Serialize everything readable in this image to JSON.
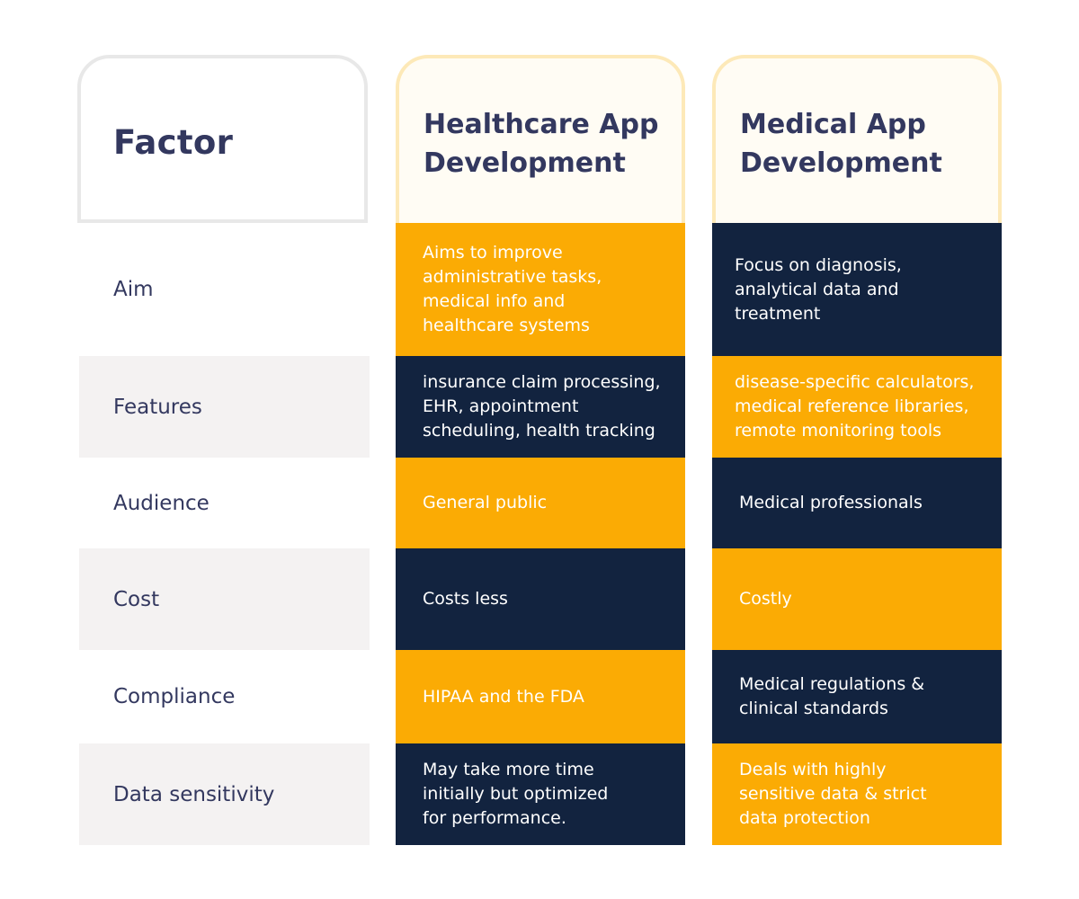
{
  "headers": {
    "factor": "Factor",
    "col1": "Healthcare App Development",
    "col2": "Medical App Development"
  },
  "colors": {
    "navy": "#12233f",
    "amber": "#fbab04",
    "text_dark": "#33385f",
    "row_shade": "#f4f2f2",
    "header_border": "#fde9b8"
  },
  "rows": [
    {
      "factor": "Aim",
      "healthcare": "Aims to improve administrative tasks, medical info and healthcare systems",
      "medical": "Focus on diagnosis, analytical data and treatment"
    },
    {
      "factor": "Features",
      "healthcare": "insurance claim processing, EHR, appointment scheduling, health tracking",
      "medical": "disease-specific calculators, medical reference libraries, remote monitoring tools"
    },
    {
      "factor": "Audience",
      "healthcare": "General public",
      "medical": "Medical professionals"
    },
    {
      "factor": "Cost",
      "healthcare": "Costs less",
      "medical": "Costly"
    },
    {
      "factor": "Compliance",
      "healthcare": "HIPAA and the FDA",
      "medical": "Medical regulations & clinical standards"
    },
    {
      "factor": "Data sensitivity",
      "healthcare": "May take more time initially but optimized for performance.",
      "medical": "Deals with highly sensitive data & strict data protection"
    }
  ]
}
